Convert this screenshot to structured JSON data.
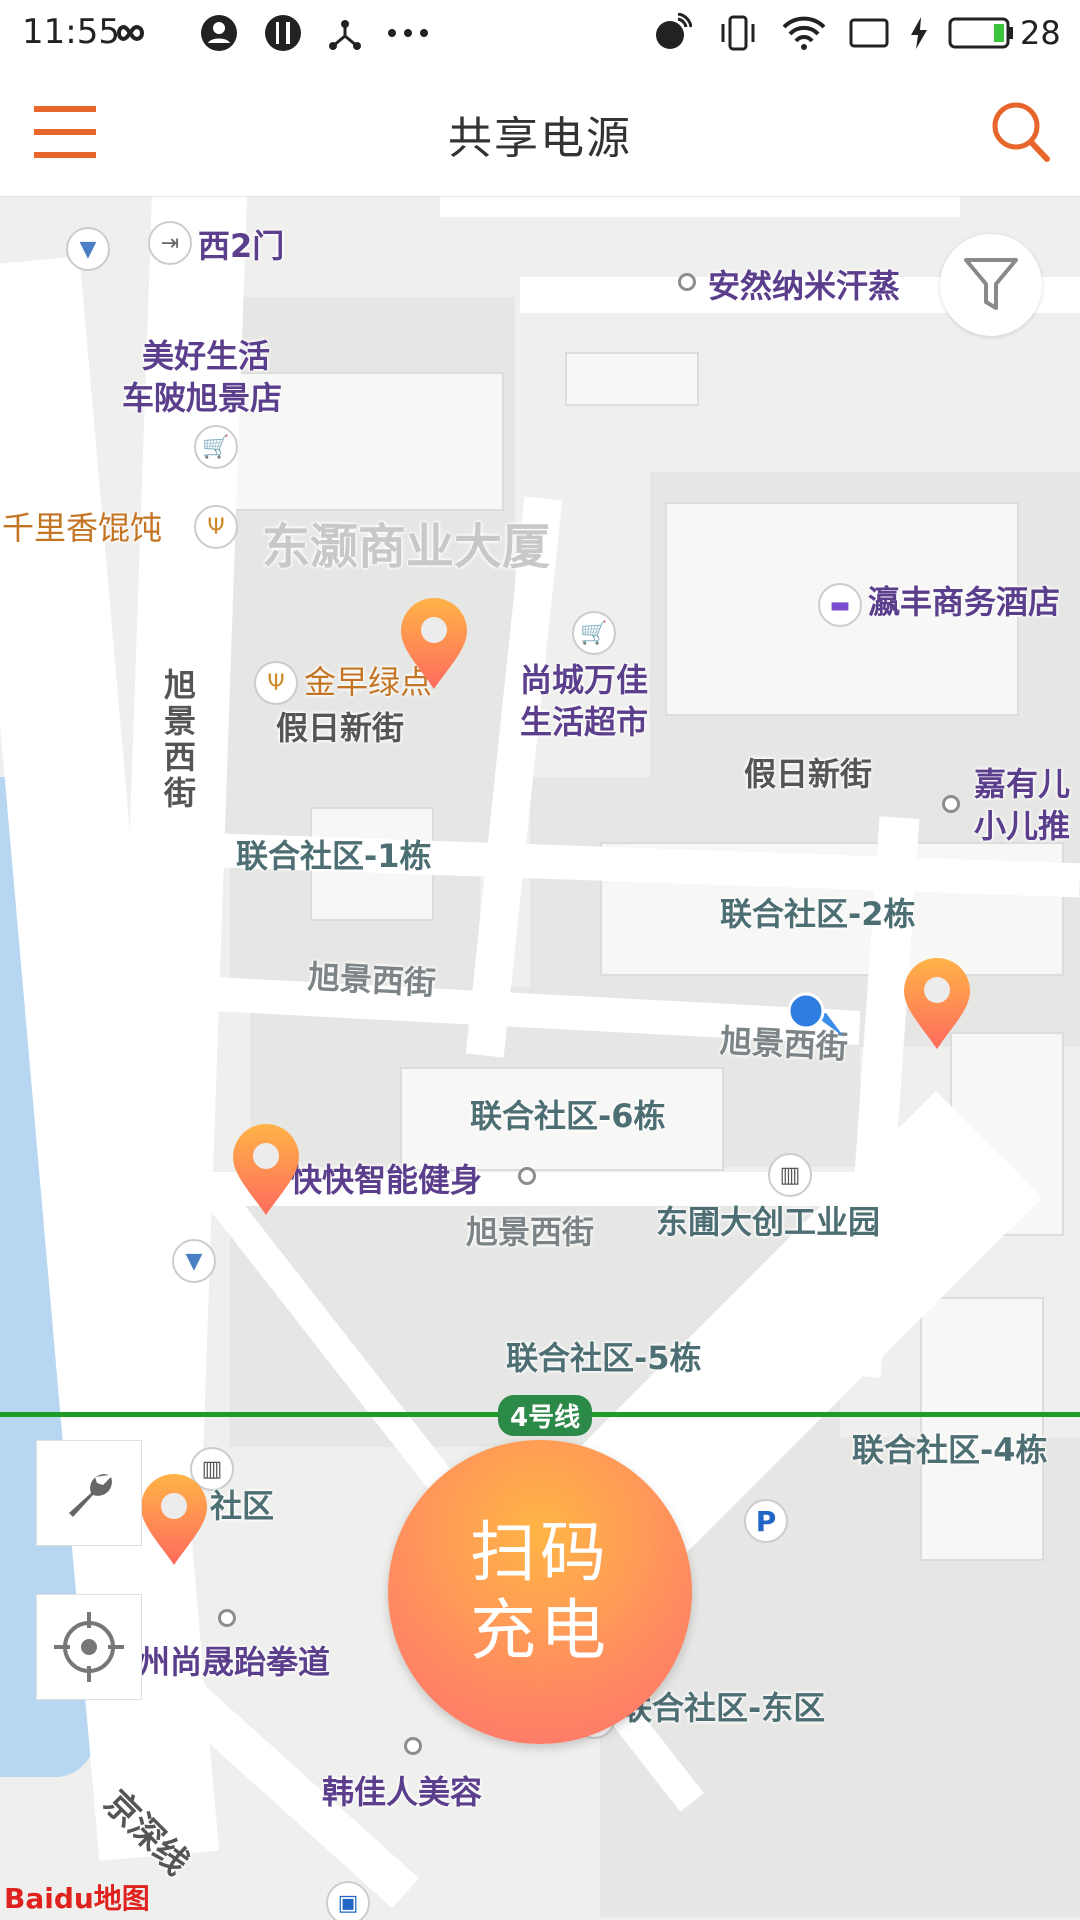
{
  "status_bar": {
    "time": "11:55",
    "battery_percent": "28",
    "icons": [
      "infinity-icon",
      "account-icon",
      "restaurant-icon",
      "network-icon",
      "more-icon",
      "call-icon",
      "vibrate-icon",
      "wifi-icon",
      "screen-icon",
      "charging-icon",
      "battery-icon"
    ]
  },
  "header": {
    "title": "共享电源",
    "menu_icon": "menu-icon",
    "search_icon": "search-icon",
    "accent_color": "#e8662b"
  },
  "map": {
    "labels": {
      "west_gate": "西2门",
      "anran": "安然纳米汗蒸",
      "meihao_1": "美好生活",
      "meihao_2": "车陂旭景店",
      "qianli": "千里香馄饨",
      "donghao": "东灏商业大厦",
      "yingfeng": "瀛丰商务酒店",
      "jinzao": "金早绿点",
      "shangcheng_1": "尚城万佳",
      "shangcheng_2": "生活超市",
      "jiari_1": "假日新街",
      "jiari_2": "假日新街",
      "jiayou_1": "嘉有儿",
      "jiayou_2": "小儿推",
      "xujing_vertical": "旭景西街",
      "lianhe_1": "联合社区-1栋",
      "lianhe_2": "联合社区-2栋",
      "xujing_1": "旭景西街",
      "xujing_2": "旭景西街",
      "xujing_3": "旭景西街",
      "lianhe_6": "联合社区-6栋",
      "kuaikuai": "快快智能健身",
      "dongpu": "东圃大创工业园",
      "lianhe_5": "联合社区-5栋",
      "line4": "4号线",
      "lianhe_4": "联合社区-4栋",
      "shequ": "社区",
      "taekwondo": "州尚晟跆拳道",
      "lianhe_east": "联合社区-东区",
      "hanjia": "韩佳人美容",
      "jingshen": "京深线",
      "parking": "P",
      "baidu_logo": "Baidu地图"
    },
    "metro_color": "#1f9b28",
    "water_color": "#b7d6f1"
  },
  "controls": {
    "scan_line1": "扫码",
    "scan_line2": "充电",
    "filter_icon": "filter-icon",
    "wrench_icon": "wrench-icon",
    "locate_icon": "locate-icon"
  }
}
